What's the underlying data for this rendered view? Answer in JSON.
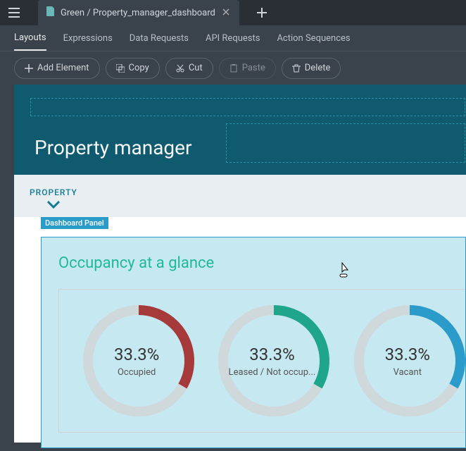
{
  "tab": {
    "title": "Green / Property_manager_dashboard"
  },
  "subtabs": [
    "Layouts",
    "Expressions",
    "Data Requests",
    "API Requests",
    "Action Sequences"
  ],
  "activeSubtab": 0,
  "toolbar": {
    "add": "Add Element",
    "copy": "Copy",
    "cut": "Cut",
    "paste": "Paste",
    "delete": "Delete"
  },
  "page": {
    "title": "Property manager"
  },
  "section": {
    "label": "PROPERTY"
  },
  "panel": {
    "badge": "Dashboard Panel",
    "title": "Occupancy at a glance"
  },
  "chart_data": [
    {
      "type": "pie",
      "title": "Occupied",
      "value_label": "33.3%",
      "value": 33.3,
      "accent": "#a63a3a",
      "base": "#cfd8db"
    },
    {
      "type": "pie",
      "title": "Leased / Not occup...",
      "value_label": "33.3%",
      "value": 33.3,
      "accent": "#1fa58a",
      "base": "#cfd8db"
    },
    {
      "type": "pie",
      "title": "Vacant",
      "value_label": "33.3%",
      "value": 33.3,
      "accent": "#2b9bc9",
      "base": "#cfd8db"
    }
  ]
}
